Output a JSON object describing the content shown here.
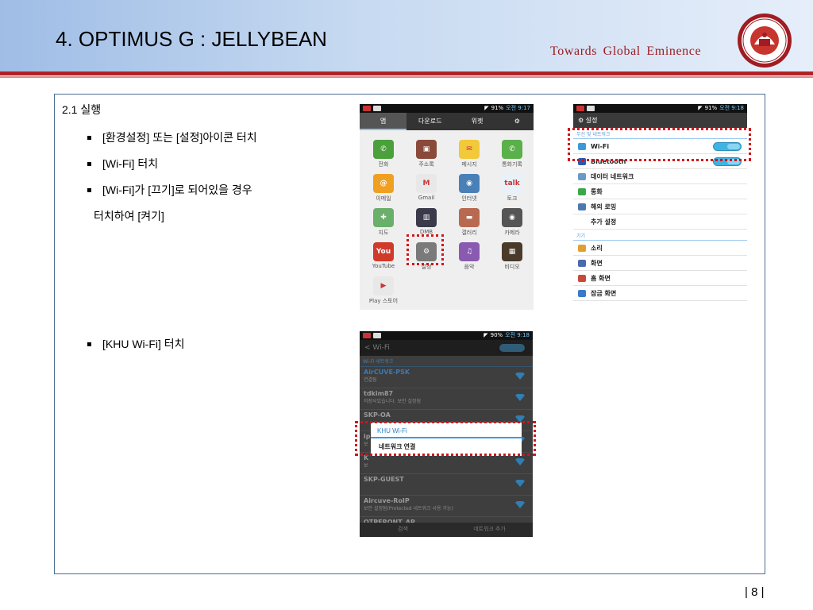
{
  "slide": {
    "title": "4. OPTIMUS G : JELLYBEAN",
    "tagline": "Towards  Global  Eminence",
    "page_number": "| 8 |"
  },
  "content": {
    "heading": "2.1 실행",
    "steps": [
      "[환경설정] 또는 [설정]아이콘 터치",
      "[Wi-Fi] 터치",
      "[Wi-Fi]가 [끄기]로 되어있을 경우",
      "[KHU Wi-Fi] 터치"
    ],
    "step3_continued": "터치하여 [켜기]"
  },
  "phone_apps": {
    "status": {
      "battery": "91%",
      "time": "오전 9:17"
    },
    "tabs": [
      "앱",
      "다운로드",
      "위젯"
    ],
    "apps": [
      {
        "label": "전화",
        "color": "#4aa03a",
        "glyph": "✆"
      },
      {
        "label": "주소록",
        "color": "#8a4a3a",
        "glyph": "▣"
      },
      {
        "label": "메시지",
        "color": "#f1c93a",
        "glyph": "✉"
      },
      {
        "label": "통화기록",
        "color": "#5ab04a",
        "glyph": "✆"
      },
      {
        "label": "이메일",
        "color": "#f0a020",
        "glyph": "@"
      },
      {
        "label": "Gmail",
        "color": "#e8e8e8",
        "glyph": "M"
      },
      {
        "label": "인터넷",
        "color": "#4a80b8",
        "glyph": "◉"
      },
      {
        "label": "토크",
        "color": "#e9f1f8",
        "glyph": "talk"
      },
      {
        "label": "지도",
        "color": "#6ab06a",
        "glyph": "✚"
      },
      {
        "label": "DMB",
        "color": "#3a3a4a",
        "glyph": "▥"
      },
      {
        "label": "갤러리",
        "color": "#b86a50",
        "glyph": "▬"
      },
      {
        "label": "카메라",
        "color": "#555555",
        "glyph": "◉"
      },
      {
        "label": "YouTube",
        "color": "#d03a2a",
        "glyph": "You"
      },
      {
        "label": "설정",
        "color": "#7a7a7a",
        "glyph": "⚙"
      },
      {
        "label": "음악",
        "color": "#8a5ab0",
        "glyph": "♫"
      },
      {
        "label": "비디오",
        "color": "#4a3a2a",
        "glyph": "▦"
      },
      {
        "label": "Play 스토어",
        "color": "#e8e8e8",
        "glyph": "▶"
      }
    ]
  },
  "phone_settings": {
    "status": {
      "battery": "91%",
      "time": "오전 9:18"
    },
    "title": "설정",
    "section1": "무선 및 네트워크",
    "rows1": [
      {
        "label": "Wi-Fi",
        "color": "#3a9ad8",
        "toggle": true
      },
      {
        "label": "Bluetooth",
        "color": "#2a5ab0",
        "toggle": true
      },
      {
        "label": "데이터 네트워크",
        "color": "#6a9ac8",
        "toggle": false
      },
      {
        "label": "통화",
        "color": "#3aa84a",
        "toggle": false
      },
      {
        "label": "해외 로밍",
        "color": "#4a7ab0",
        "toggle": false
      },
      {
        "label": "추가 설정",
        "color": "",
        "toggle": false
      }
    ],
    "section2": "기기",
    "rows2": [
      {
        "label": "소리",
        "color": "#e0a030"
      },
      {
        "label": "화면",
        "color": "#4a6ab0"
      },
      {
        "label": "홈 화면",
        "color": "#c84a3a"
      },
      {
        "label": "잠금 화면",
        "color": "#3a7ac8"
      }
    ]
  },
  "phone_wifi": {
    "status": {
      "battery": "90%",
      "time": "오전 9:18"
    },
    "title": "Wi-Fi",
    "section": "Wi-Fi 네트워크",
    "networks": [
      {
        "name": "AirCUVE-PSK",
        "sub": "연결됨",
        "color": "#3a7ab8"
      },
      {
        "name": "tdkim87",
        "sub": "저장되었습니다. 보안 설정됨",
        "color": "#9a9a9a"
      },
      {
        "name": "SKP-OA",
        "sub": "",
        "color": "#9a9a9a"
      },
      {
        "name": "ip",
        "sub": "보",
        "color": "#9a9a9a"
      },
      {
        "name": "K",
        "sub": "보",
        "color": "#9a9a9a"
      },
      {
        "name": "SKP-GUEST",
        "sub": "",
        "color": "#9a9a9a"
      },
      {
        "name": "Aircuve-RoIP",
        "sub": "보안 설정됨(Protected 네트워크 사용 가능)",
        "color": "#9a9a9a"
      },
      {
        "name": "OTPFRONT_AP",
        "sub": "",
        "color": "#9a9a9a"
      }
    ],
    "dialog_title": "KHU Wi-Fi",
    "dialog_item": "네트워크 연결",
    "footer": [
      "검색",
      "네트워크 추가"
    ]
  }
}
